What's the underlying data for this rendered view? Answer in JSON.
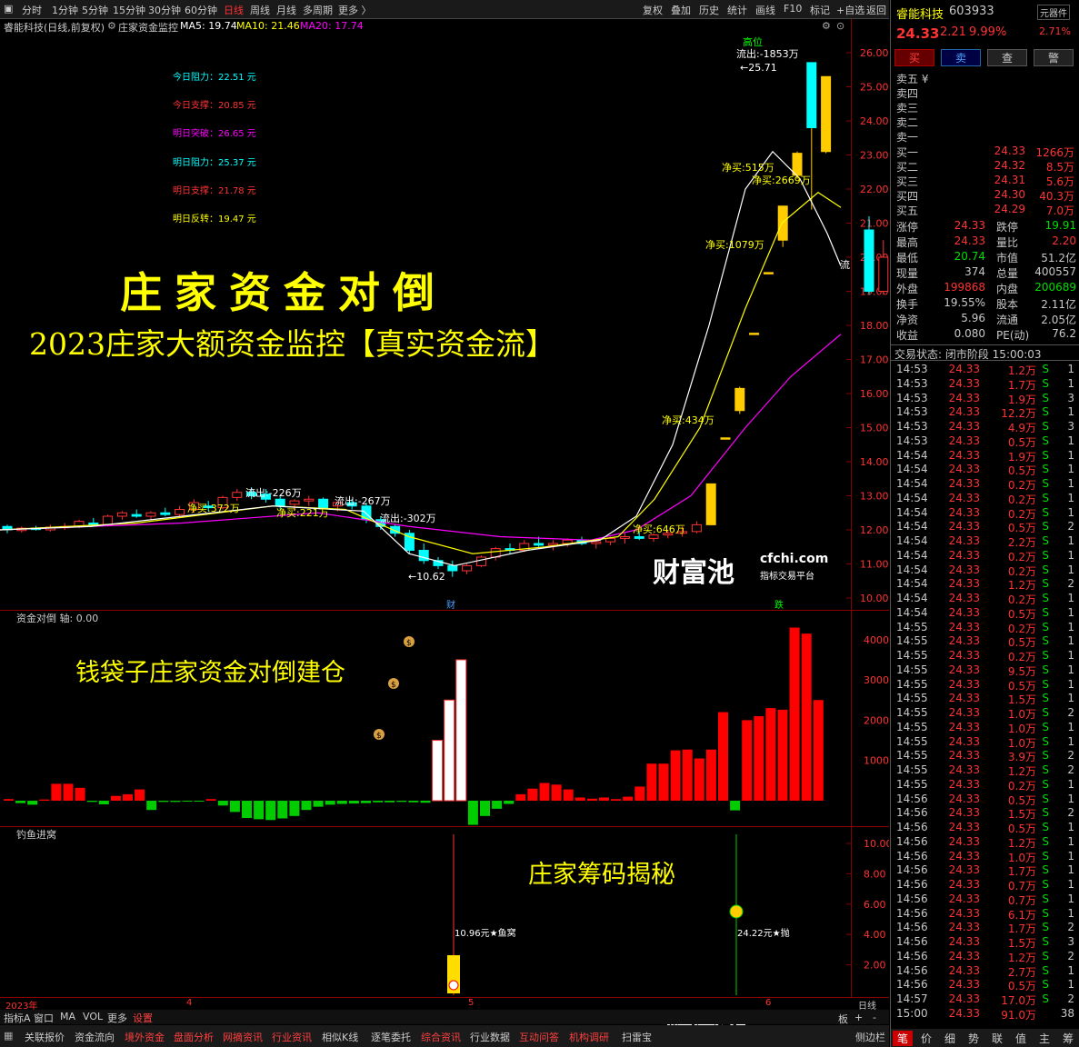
{
  "toolbar": {
    "timeframes": [
      "分时",
      "1分钟",
      "5分钟",
      "15分钟",
      "30分钟",
      "60分钟",
      "日线",
      "周线",
      "月线",
      "多周期",
      "更多 〉"
    ],
    "active": "日线",
    "tools": [
      "复权",
      "叠加",
      "历史",
      "统计",
      "画线",
      "F10",
      "标记",
      "+自选",
      "返回"
    ]
  },
  "info": {
    "name": "睿能科技(日线,前复权)",
    "indicator": "庄家资金监控",
    "ma5": "MA5: 19.74",
    "ma10": "MA10: 21.46",
    "ma20": "MA20: 17.74"
  },
  "levels": [
    {
      "label": "今日阻力：22.51 元",
      "color": "#00ffff"
    },
    {
      "label": "今日支撑：20.85 元",
      "color": "#ff3333"
    },
    {
      "label": "明日突破：26.65 元",
      "color": "#ff00ff"
    },
    {
      "label": "明日阻力：25.37 元",
      "color": "#00ffff"
    },
    {
      "label": "明日支撑：21.78 元",
      "color": "#ff3333"
    },
    {
      "label": "明日反转：19.47 元",
      "color": "#ffff00"
    }
  ],
  "overlay": {
    "title": "庄家资金对倒",
    "subtitle": "2023庄家大额资金监控【真实资金流】",
    "sub1_caption": "钱袋子庄家资金对倒建仓",
    "sub2_caption": "庄家筹码揭秘"
  },
  "logo": {
    "cn": "财富池",
    "url": "cfchi.com",
    "tag": "指标交易平台"
  },
  "chart_data": {
    "type": "candlestick",
    "y_axis": [
      "26.00",
      "25.00",
      "24.00",
      "23.00",
      "22.00",
      "21.00",
      "20.00",
      "19.00",
      "18.00",
      "17.00",
      "16.00",
      "15.00",
      "14.00",
      "13.00",
      "12.00",
      "11.00",
      "10.00"
    ],
    "ohlc": [
      [
        12.1,
        12.15,
        11.9,
        12.0
      ],
      [
        11.98,
        12.1,
        11.92,
        12.05
      ],
      [
        12.05,
        12.12,
        11.98,
        12.02
      ],
      [
        12.0,
        12.15,
        11.95,
        12.08
      ],
      [
        12.08,
        12.2,
        12.0,
        12.1
      ],
      [
        12.1,
        12.3,
        12.05,
        12.25
      ],
      [
        12.2,
        12.35,
        12.1,
        12.15
      ],
      [
        12.15,
        12.45,
        12.1,
        12.4
      ],
      [
        12.4,
        12.55,
        12.3,
        12.5
      ],
      [
        12.45,
        12.6,
        12.35,
        12.4
      ],
      [
        12.4,
        12.55,
        12.3,
        12.5
      ],
      [
        12.5,
        12.65,
        12.4,
        12.45
      ],
      [
        12.45,
        12.7,
        12.4,
        12.6
      ],
      [
        12.6,
        12.9,
        12.5,
        12.8
      ],
      [
        12.7,
        12.85,
        12.55,
        12.65
      ],
      [
        12.65,
        13.0,
        12.6,
        12.95
      ],
      [
        12.95,
        13.2,
        12.85,
        13.1
      ],
      [
        13.1,
        13.25,
        12.9,
        13.0
      ],
      [
        13.05,
        13.2,
        12.8,
        12.9
      ],
      [
        12.9,
        13.0,
        12.6,
        12.7
      ],
      [
        12.75,
        12.9,
        12.55,
        12.85
      ],
      [
        12.85,
        13.0,
        12.7,
        12.9
      ],
      [
        12.9,
        12.95,
        12.6,
        12.65
      ],
      [
        12.7,
        12.85,
        12.55,
        12.8
      ],
      [
        12.8,
        12.9,
        12.6,
        12.7
      ],
      [
        12.7,
        12.8,
        12.2,
        12.3
      ],
      [
        12.3,
        12.4,
        12.0,
        12.1
      ],
      [
        12.1,
        12.15,
        11.8,
        11.9
      ],
      [
        11.9,
        12.0,
        11.3,
        11.4
      ],
      [
        11.4,
        11.6,
        11.0,
        11.1
      ],
      [
        11.1,
        11.2,
        10.85,
        10.95
      ],
      [
        10.95,
        11.1,
        10.62,
        10.8
      ],
      [
        10.8,
        11.0,
        10.7,
        10.95
      ],
      [
        10.95,
        11.25,
        10.9,
        11.2
      ],
      [
        11.2,
        11.5,
        11.1,
        11.45
      ],
      [
        11.45,
        11.6,
        11.3,
        11.4
      ],
      [
        11.4,
        11.7,
        11.35,
        11.6
      ],
      [
        11.6,
        11.8,
        11.5,
        11.55
      ],
      [
        11.55,
        11.7,
        11.4,
        11.6
      ],
      [
        11.6,
        11.75,
        11.5,
        11.7
      ],
      [
        11.7,
        11.8,
        11.55,
        11.6
      ],
      [
        11.6,
        11.7,
        11.45,
        11.65
      ],
      [
        11.65,
        11.8,
        11.55,
        11.75
      ],
      [
        11.75,
        11.9,
        11.6,
        11.8
      ],
      [
        11.8,
        11.95,
        11.7,
        11.75
      ],
      [
        11.75,
        11.9,
        11.65,
        11.85
      ],
      [
        11.85,
        12.0,
        11.75,
        11.9
      ],
      [
        11.9,
        12.1,
        11.8,
        11.95
      ],
      [
        11.95,
        12.25,
        11.9,
        12.15
      ],
      [
        12.15,
        13.35,
        12.15,
        13.35
      ],
      [
        14.7,
        14.7,
        14.7,
        14.7
      ],
      [
        15.5,
        16.2,
        15.4,
        16.15
      ],
      [
        17.77,
        17.77,
        17.77,
        17.77
      ],
      [
        19.55,
        19.55,
        19.55,
        19.55
      ],
      [
        20.5,
        21.5,
        20.3,
        21.5
      ],
      [
        22.4,
        23.1,
        22.3,
        23.05
      ],
      [
        25.71,
        25.71,
        21.4,
        23.8
      ],
      [
        23.1,
        25.3,
        23.05,
        25.3
      ],
      [
        0,
        0,
        0,
        0
      ],
      [
        0,
        0,
        0,
        0
      ],
      [
        20.8,
        21.2,
        18.9,
        19.0
      ],
      [
        19.0,
        20.5,
        18.9,
        20.0
      ],
      [
        20.3,
        20.5,
        19.0,
        19.1
      ],
      [
        19.2,
        19.6,
        18.4,
        18.7
      ],
      [
        18.8,
        19.5,
        18.5,
        19.3
      ]
    ],
    "ma5": [
      [
        0,
        12.0
      ],
      [
        100,
        12.1
      ],
      [
        200,
        12.4
      ],
      [
        300,
        12.7
      ],
      [
        400,
        12.55
      ],
      [
        450,
        11.3
      ],
      [
        500,
        10.95
      ],
      [
        580,
        11.4
      ],
      [
        660,
        11.7
      ],
      [
        700,
        12.4
      ],
      [
        740,
        14.5
      ],
      [
        780,
        18.0
      ],
      [
        820,
        22.0
      ],
      [
        850,
        23.1
      ],
      [
        880,
        22.3
      ],
      [
        910,
        20.7
      ],
      [
        925,
        19.74
      ]
    ],
    "ma10": [
      [
        0,
        12.0
      ],
      [
        150,
        12.2
      ],
      [
        300,
        12.7
      ],
      [
        380,
        12.6
      ],
      [
        450,
        11.8
      ],
      [
        520,
        11.3
      ],
      [
        600,
        11.5
      ],
      [
        680,
        11.8
      ],
      [
        720,
        12.9
      ],
      [
        770,
        15.0
      ],
      [
        820,
        18.5
      ],
      [
        860,
        21.0
      ],
      [
        900,
        21.9
      ],
      [
        925,
        21.46
      ]
    ],
    "ma20": [
      [
        0,
        12.0
      ],
      [
        200,
        12.2
      ],
      [
        350,
        12.5
      ],
      [
        450,
        12.1
      ],
      [
        550,
        11.8
      ],
      [
        650,
        11.7
      ],
      [
        700,
        12.0
      ],
      [
        760,
        13.0
      ],
      [
        820,
        15.0
      ],
      [
        870,
        16.5
      ],
      [
        925,
        17.74
      ]
    ],
    "annotations": [
      {
        "text": "流出:-226万",
        "color": "#ffffff"
      },
      {
        "text": "净买:372万",
        "color": "#ffff00"
      },
      {
        "text": "流出:-267万",
        "color": "#ffffff"
      },
      {
        "text": "净买:221万",
        "color": "#ffff00"
      },
      {
        "text": "流出:-302万",
        "color": "#ffffff"
      },
      {
        "text": "←10.62",
        "color": "#ffffff"
      },
      {
        "text": "净买:646万",
        "color": "#ffff00"
      },
      {
        "text": "净买:434万",
        "color": "#ffff00"
      },
      {
        "text": "净买:1079万",
        "color": "#ffff00"
      },
      {
        "text": "净买:515万",
        "color": "#ffff00"
      },
      {
        "text": "净买:2669万",
        "color": "#ffff00"
      },
      {
        "text": "流出:-1853万",
        "color": "#ffffff"
      },
      {
        "text": "←25.71",
        "color": "#ffffff"
      },
      {
        "text": "高位",
        "color": "#00ff00"
      },
      {
        "text": "流",
        "color": "#ffffff"
      }
    ],
    "sub1_title": "资金对倒 轴: 0.00",
    "sub1_axis": [
      "4000",
      "3000",
      "2000",
      "1000"
    ],
    "sub1_bars": [
      40,
      -60,
      -100,
      30,
      420,
      420,
      320,
      -30,
      -90,
      120,
      160,
      280,
      -230,
      -30,
      -30,
      -10,
      -10,
      40,
      -120,
      -280,
      -430,
      -460,
      -480,
      -440,
      -380,
      -230,
      -150,
      -100,
      -80,
      -70,
      -60,
      -40,
      -40,
      -30,
      -40,
      -50,
      1500,
      2500,
      3500,
      -600,
      -380,
      -200,
      -80,
      160,
      300,
      440,
      400,
      280,
      80,
      50,
      80,
      40,
      100,
      350,
      920,
      920,
      1250,
      1270,
      1050,
      1270,
      2200,
      -240,
      2000,
      2100,
      2300,
      2260,
      4300,
      4150,
      2500
    ],
    "sub1_marks": [
      "$",
      "$",
      "$"
    ],
    "sub2_title": "钓鱼进窝",
    "sub2_axis": [
      "10.00",
      "8.00",
      "6.00",
      "4.00",
      "2.00"
    ],
    "sub2_labels": [
      "10.96元★鱼窝",
      "24.22元★抛"
    ],
    "dates": [
      "2023年",
      "4",
      "5",
      "6",
      "日线"
    ],
    "markers": [
      "财",
      "跌"
    ]
  },
  "tabs": [
    "指标A",
    "窗口",
    "MA",
    "VOL",
    "更多",
    "设置"
  ],
  "bottom_tabs": [
    "关联报价",
    "资金流向",
    "境外资金",
    "盘面分析",
    "网摘资讯",
    "行业资讯",
    "相似K线",
    "逐笔委托",
    "综合资讯",
    "行业数据",
    "互动问答",
    "机构调研",
    "扫雷宝"
  ],
  "bottom_right": [
    "板",
    "+",
    "-",
    "侧边栏"
  ],
  "quote": {
    "name": "睿能科技",
    "code": "603933",
    "unit": "元器件",
    "price": "24.33",
    "change": "2.21",
    "pct": "9.99%",
    "pct2": "2.71%",
    "actions": [
      "买",
      "卖",
      "查",
      "警"
    ],
    "sells": [
      "卖五 ¥",
      "卖四",
      "卖三",
      "卖二",
      "卖一"
    ],
    "buys": [
      [
        "买一",
        "24.33",
        "1266万"
      ],
      [
        "买二",
        "24.32",
        "8.5万"
      ],
      [
        "买三",
        "24.31",
        "5.6万"
      ],
      [
        "买四",
        "24.30",
        "40.3万"
      ],
      [
        "买五",
        "24.29",
        "7.0万"
      ]
    ],
    "stats": [
      [
        "涨停",
        "24.33",
        "跌停",
        "19.91"
      ],
      [
        "最高",
        "24.33",
        "量比",
        "2.20"
      ],
      [
        "最低",
        "20.74",
        "市值",
        "51.2亿"
      ],
      [
        "现量",
        "374",
        "总量",
        "400557"
      ],
      [
        "外盘",
        "199868",
        "内盘",
        "200689"
      ],
      [
        "换手",
        "19.55%",
        "股本",
        "2.11亿"
      ],
      [
        "净资",
        "5.96",
        "流通",
        "2.05亿"
      ],
      [
        "收益",
        "0.080",
        "PE(动)",
        "76.2"
      ]
    ],
    "status": "交易状态: 闭市阶段 15:00:03",
    "ticks": [
      [
        "14:53",
        "24.33",
        "1.2万",
        "S",
        "1"
      ],
      [
        "14:53",
        "24.33",
        "1.7万",
        "S",
        "1"
      ],
      [
        "14:53",
        "24.33",
        "1.9万",
        "S",
        "3"
      ],
      [
        "14:53",
        "24.33",
        "12.2万",
        "S",
        "1"
      ],
      [
        "14:53",
        "24.33",
        "4.9万",
        "S",
        "3"
      ],
      [
        "14:53",
        "24.33",
        "0.5万",
        "S",
        "1"
      ],
      [
        "14:54",
        "24.33",
        "1.9万",
        "S",
        "1"
      ],
      [
        "14:54",
        "24.33",
        "0.5万",
        "S",
        "1"
      ],
      [
        "14:54",
        "24.33",
        "0.2万",
        "S",
        "1"
      ],
      [
        "14:54",
        "24.33",
        "0.2万",
        "S",
        "1"
      ],
      [
        "14:54",
        "24.33",
        "0.2万",
        "S",
        "1"
      ],
      [
        "14:54",
        "24.33",
        "0.5万",
        "S",
        "2"
      ],
      [
        "14:54",
        "24.33",
        "2.2万",
        "S",
        "1"
      ],
      [
        "14:54",
        "24.33",
        "0.2万",
        "S",
        "1"
      ],
      [
        "14:54",
        "24.33",
        "0.2万",
        "S",
        "1"
      ],
      [
        "14:54",
        "24.33",
        "1.2万",
        "S",
        "2"
      ],
      [
        "14:54",
        "24.33",
        "0.2万",
        "S",
        "1"
      ],
      [
        "14:54",
        "24.33",
        "0.5万",
        "S",
        "1"
      ],
      [
        "14:55",
        "24.33",
        "0.2万",
        "S",
        "1"
      ],
      [
        "14:55",
        "24.33",
        "0.5万",
        "S",
        "1"
      ],
      [
        "14:55",
        "24.33",
        "0.2万",
        "S",
        "1"
      ],
      [
        "14:55",
        "24.33",
        "9.5万",
        "S",
        "1"
      ],
      [
        "14:55",
        "24.33",
        "0.5万",
        "S",
        "1"
      ],
      [
        "14:55",
        "24.33",
        "1.5万",
        "S",
        "1"
      ],
      [
        "14:55",
        "24.33",
        "1.0万",
        "S",
        "2"
      ],
      [
        "14:55",
        "24.33",
        "1.0万",
        "S",
        "1"
      ],
      [
        "14:55",
        "24.33",
        "1.0万",
        "S",
        "1"
      ],
      [
        "14:55",
        "24.33",
        "3.9万",
        "S",
        "2"
      ],
      [
        "14:55",
        "24.33",
        "1.2万",
        "S",
        "2"
      ],
      [
        "14:55",
        "24.33",
        "0.2万",
        "S",
        "1"
      ],
      [
        "14:56",
        "24.33",
        "0.5万",
        "S",
        "1"
      ],
      [
        "14:56",
        "24.33",
        "1.5万",
        "S",
        "2"
      ],
      [
        "14:56",
        "24.33",
        "0.5万",
        "S",
        "1"
      ],
      [
        "14:56",
        "24.33",
        "1.2万",
        "S",
        "1"
      ],
      [
        "14:56",
        "24.33",
        "1.0万",
        "S",
        "1"
      ],
      [
        "14:56",
        "24.33",
        "1.7万",
        "S",
        "1"
      ],
      [
        "14:56",
        "24.33",
        "0.7万",
        "S",
        "1"
      ],
      [
        "14:56",
        "24.33",
        "0.7万",
        "S",
        "1"
      ],
      [
        "14:56",
        "24.33",
        "6.1万",
        "S",
        "1"
      ],
      [
        "14:56",
        "24.33",
        "1.7万",
        "S",
        "2"
      ],
      [
        "14:56",
        "24.33",
        "1.5万",
        "S",
        "3"
      ],
      [
        "14:56",
        "24.33",
        "1.2万",
        "S",
        "2"
      ],
      [
        "14:56",
        "24.33",
        "2.7万",
        "S",
        "1"
      ],
      [
        "14:56",
        "24.33",
        "0.5万",
        "S",
        "1"
      ],
      [
        "14:57",
        "24.33",
        "17.0万",
        "S",
        "2"
      ],
      [
        "15:00",
        "24.33",
        "91.0万",
        "",
        "38"
      ]
    ],
    "footer": [
      "笔",
      "价",
      "细",
      "势",
      "联",
      "值",
      "主",
      "筹"
    ]
  }
}
